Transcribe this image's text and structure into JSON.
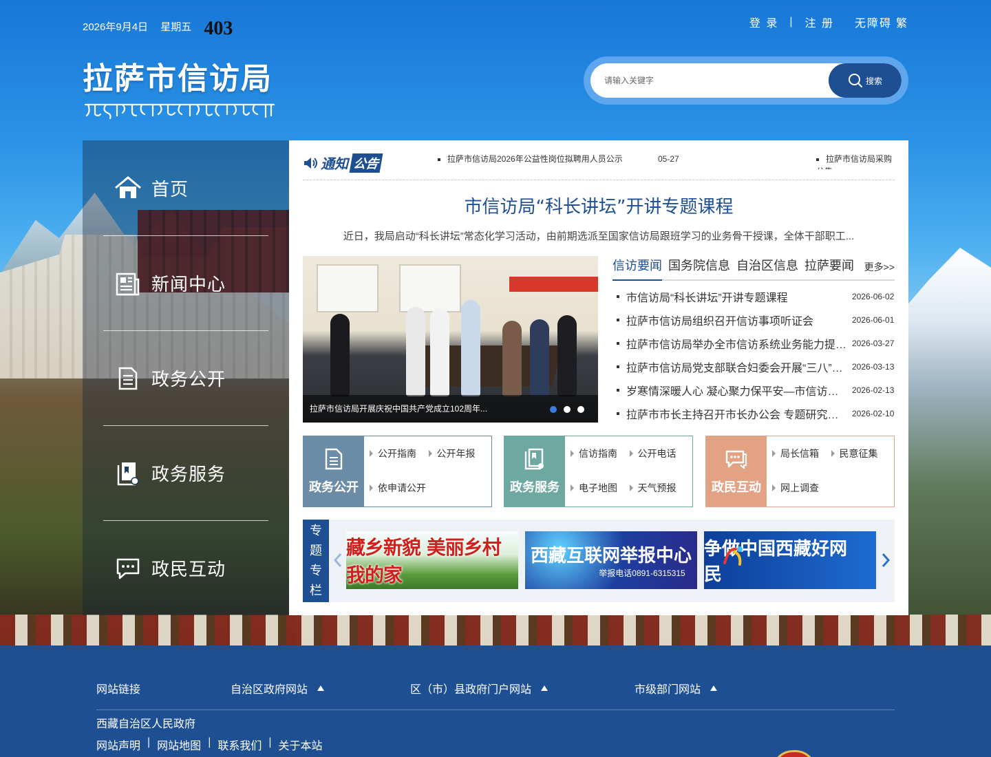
{
  "header": {
    "date": "2026年9月4日",
    "weekday": "星期五",
    "counter": "403",
    "login": "登 录",
    "separator": "|",
    "register": "注 册",
    "accessibility": "无障碍",
    "traditional": "繁",
    "site_title": "拉萨市信访局",
    "search_placeholder": "请输入关键字",
    "search_button": "搜索"
  },
  "colors": {
    "primary": "#1f4f93",
    "box_gov_open": "#6b8ca6",
    "box_gov_service": "#6ea9a1",
    "box_interaction": "#e4a285"
  },
  "sidebar": {
    "items": [
      {
        "label": "首页",
        "icon": "home-icon"
      },
      {
        "label": "新闻中心",
        "icon": "newspaper-icon"
      },
      {
        "label": "政务公开",
        "icon": "document-icon"
      },
      {
        "label": "政务服务",
        "icon": "service-icon"
      },
      {
        "label": "政民互动",
        "icon": "chat-icon"
      }
    ]
  },
  "notice": {
    "label_1": "通知",
    "label_2": "公告",
    "item_1": "拉萨市信访局2026年公益性岗位拟聘用人员公示",
    "item_1_date": "05-27",
    "item_2": "拉萨市信访局采购公告"
  },
  "headline": {
    "title": "市信访局“科长讲坛”开讲专题课程",
    "summary": "近日，我局启动“科长讲坛”常态化学习活动，由前期选派至国家信访局跟班学习的业务骨干授课，全体干部职工..."
  },
  "slideshow": {
    "caption": "拉萨市信访局开展庆祝中国共产党成立102周年...",
    "active_index": 0,
    "count": 3
  },
  "news": {
    "tabs": [
      "信访要闻",
      "国务院信息",
      "自治区信息",
      "拉萨要闻"
    ],
    "more": "更多>>",
    "items": [
      {
        "title": "市信访局“科长讲坛”开讲专题课程",
        "date": "2026-06-02"
      },
      {
        "title": "拉萨市信访局组织召开信访事项听证会",
        "date": "2026-06-01"
      },
      {
        "title": "拉萨市信访局举办全市信访系统业务能力提升培训班",
        "date": "2026-03-27"
      },
      {
        "title": "拉萨市信访局党支部联合妇委会开展“三八”妇女节活动",
        "date": "2026-03-13"
      },
      {
        "title": "岁寒情深暖人心 凝心聚力保平安—市信访局开展走访慰问",
        "date": "2026-02-13"
      },
      {
        "title": "拉萨市市长主持召开市长办公会 专题研究部署信访工作",
        "date": "2026-02-10"
      }
    ]
  },
  "boxes": {
    "gov_open": {
      "title": "政务公开",
      "links": [
        "公开指南",
        "公开年报",
        "依申请公开"
      ]
    },
    "gov_service": {
      "title": "政务服务",
      "links": [
        "信访指南",
        "公开电话",
        "电子地图",
        "天气预报"
      ]
    },
    "interaction": {
      "title": "政民互动",
      "links": [
        "局长信箱",
        "民意征集",
        "网上调查"
      ]
    }
  },
  "special": {
    "label": [
      "专",
      "题",
      "专",
      "栏"
    ],
    "banner_1": "藏乡新貌 美丽乡村我的家",
    "banner_2": "西藏互联网举报中心",
    "banner_2_phone": "举报电话0891-6315315",
    "banner_3": "争做中国西藏好网民"
  },
  "footer": {
    "site_links": "网站链接",
    "region_sites": "自治区政府网站",
    "county_sites": "区（市）县政府门户网站",
    "city_dept_sites": "市级部门网站",
    "gov_link": "西藏自治区人民政府",
    "links": [
      "网站声明",
      "网站地图",
      "联系我们",
      "关于本站"
    ],
    "sep": "|"
  }
}
